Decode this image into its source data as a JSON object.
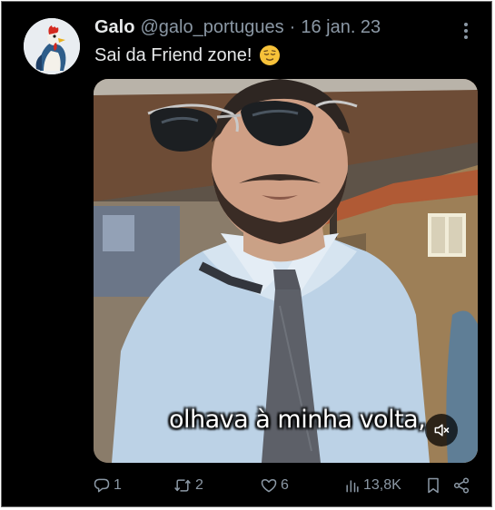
{
  "tweet": {
    "author_name": "Galo",
    "handle": "@galo_portugues",
    "separator": "·",
    "date": "16 jan. 23",
    "text": "Sai da Friend zone!",
    "emoji_icon": "relieved-face-emoji"
  },
  "media": {
    "caption": "olhava à minha volta,",
    "mute_icon": "speaker-muted-icon"
  },
  "actions": {
    "replies": "1",
    "reposts": "2",
    "likes": "6",
    "views": "13,8K"
  },
  "colors": {
    "background": "#000000",
    "text_primary": "#e7e9ea",
    "text_secondary": "#8b98a5"
  }
}
